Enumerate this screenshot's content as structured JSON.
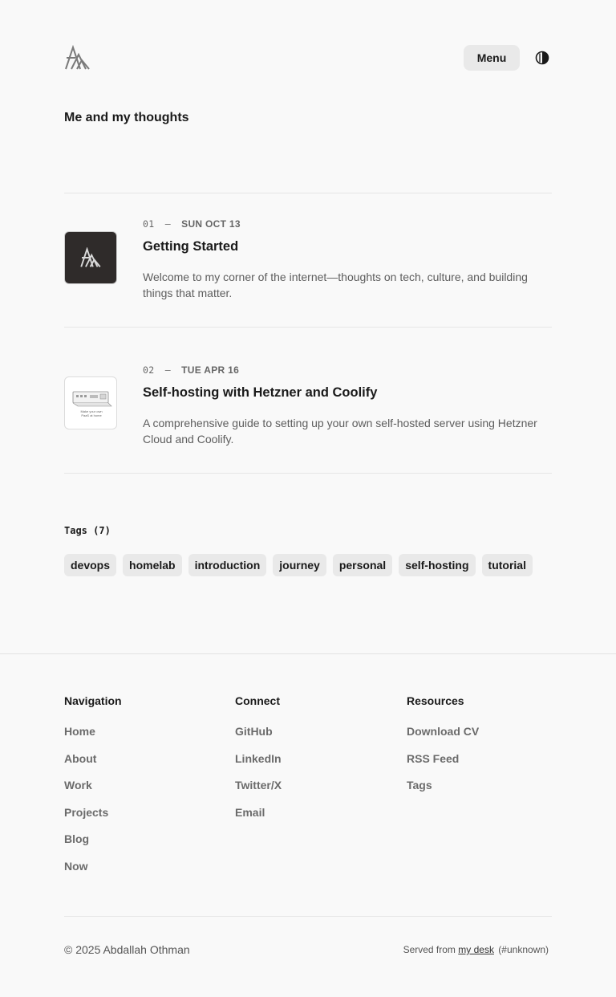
{
  "header": {
    "menu_label": "Menu",
    "logo_icon": "author-monogram-logo",
    "theme_icon": "contrast-half-circle-icon"
  },
  "page": {
    "title": "Me and my thoughts"
  },
  "posts": [
    {
      "index": "01",
      "separator": "–",
      "date": "SUN OCT 13",
      "title": "Getting Started",
      "description": "Welcome to my corner of the internet—thoughts on tech, culture, and building things that matter."
    },
    {
      "index": "02",
      "separator": "–",
      "date": "TUE APR 16",
      "title": "Self-hosting with Hetzner and Coolify",
      "description": "A comprehensive guide to setting up your own self-hosted server using Hetzner Cloud and Coolify.",
      "thumb_caption": "Make your own PaaS at home"
    }
  ],
  "tags": {
    "heading": "Tags (7)",
    "items": [
      "devops",
      "homelab",
      "introduction",
      "journey",
      "personal",
      "self-hosting",
      "tutorial"
    ]
  },
  "footer": {
    "navigation": {
      "heading": "Navigation",
      "links": [
        "Home",
        "About",
        "Work",
        "Projects",
        "Blog",
        "Now"
      ]
    },
    "connect": {
      "heading": "Connect",
      "links": [
        "GitHub",
        "LinkedIn",
        "Twitter/X",
        "Email"
      ]
    },
    "resources": {
      "heading": "Resources",
      "links": [
        "Download CV",
        "RSS Feed",
        "Tags"
      ]
    },
    "copyright": "© 2025 Abdallah Othman",
    "served_prefix": "Served from",
    "served_link": "my desk",
    "served_suffix": "(#unknown)"
  },
  "colors": {
    "background": "#f9f9f9",
    "chip": "#e9e9e9",
    "text": "#1a1a1a",
    "muted": "#6b6b6b",
    "divider": "#e6e6e6",
    "thumb_dark": "#2f2b2a"
  }
}
